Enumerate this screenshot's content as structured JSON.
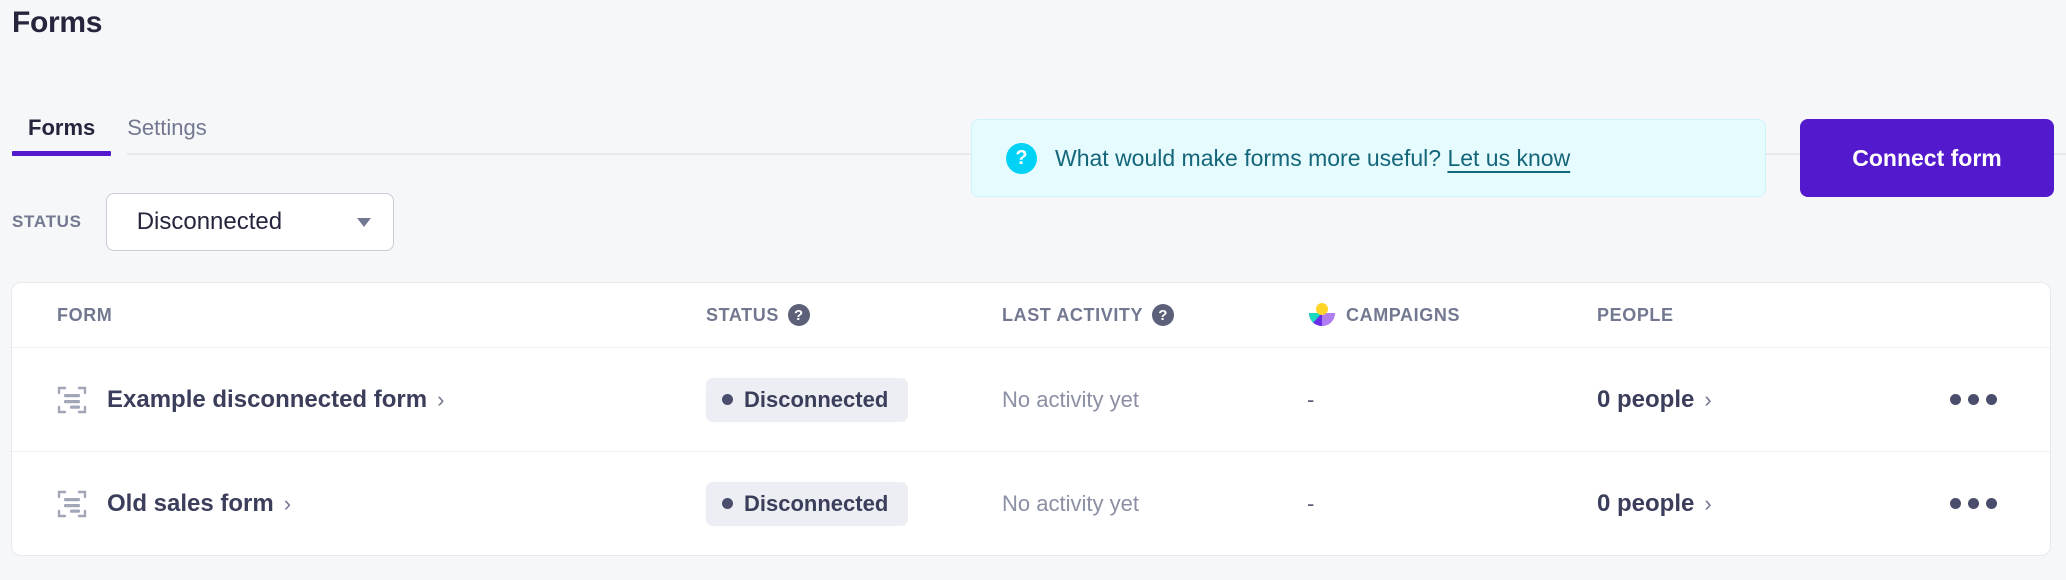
{
  "page": {
    "title": "Forms",
    "background_color": "#f6f7f9"
  },
  "tabs": [
    {
      "label": "Forms",
      "active": true
    },
    {
      "label": "Settings",
      "active": false
    }
  ],
  "banner": {
    "icon": "question-mark-icon",
    "text": "What would make forms more useful?",
    "link_label": "Let us know",
    "background_color": "#e6fbfe",
    "icon_color": "#00d2f5",
    "text_color": "#14667a"
  },
  "primary_action": {
    "label": "Connect form",
    "color": "#5319cc"
  },
  "filter": {
    "label": "STATUS",
    "selected_value": "Disconnected",
    "options": [
      "Disconnected"
    ]
  },
  "table": {
    "columns": [
      {
        "label": "FORM",
        "has_help": false
      },
      {
        "label": "STATUS",
        "has_help": true,
        "help_glyph": "?"
      },
      {
        "label": "LAST ACTIVITY",
        "has_help": true,
        "help_glyph": "?"
      },
      {
        "label": "CAMPAIGNS",
        "has_help": false,
        "icon": "campaigns-logo-icon"
      },
      {
        "label": "PEOPLE",
        "has_help": false
      }
    ],
    "rows": [
      {
        "icon": "form-icon",
        "name": "Example disconnected form",
        "chevron": "›",
        "status": "Disconnected",
        "last_activity": "No activity yet",
        "campaigns": "-",
        "people": "0 people",
        "people_chevron": "›",
        "menu": "more-options-icon"
      },
      {
        "icon": "form-icon",
        "name": "Old sales form",
        "chevron": "›",
        "status": "Disconnected",
        "last_activity": "No activity yet",
        "campaigns": "-",
        "people": "0 people",
        "people_chevron": "›",
        "menu": "more-options-icon"
      }
    ]
  }
}
